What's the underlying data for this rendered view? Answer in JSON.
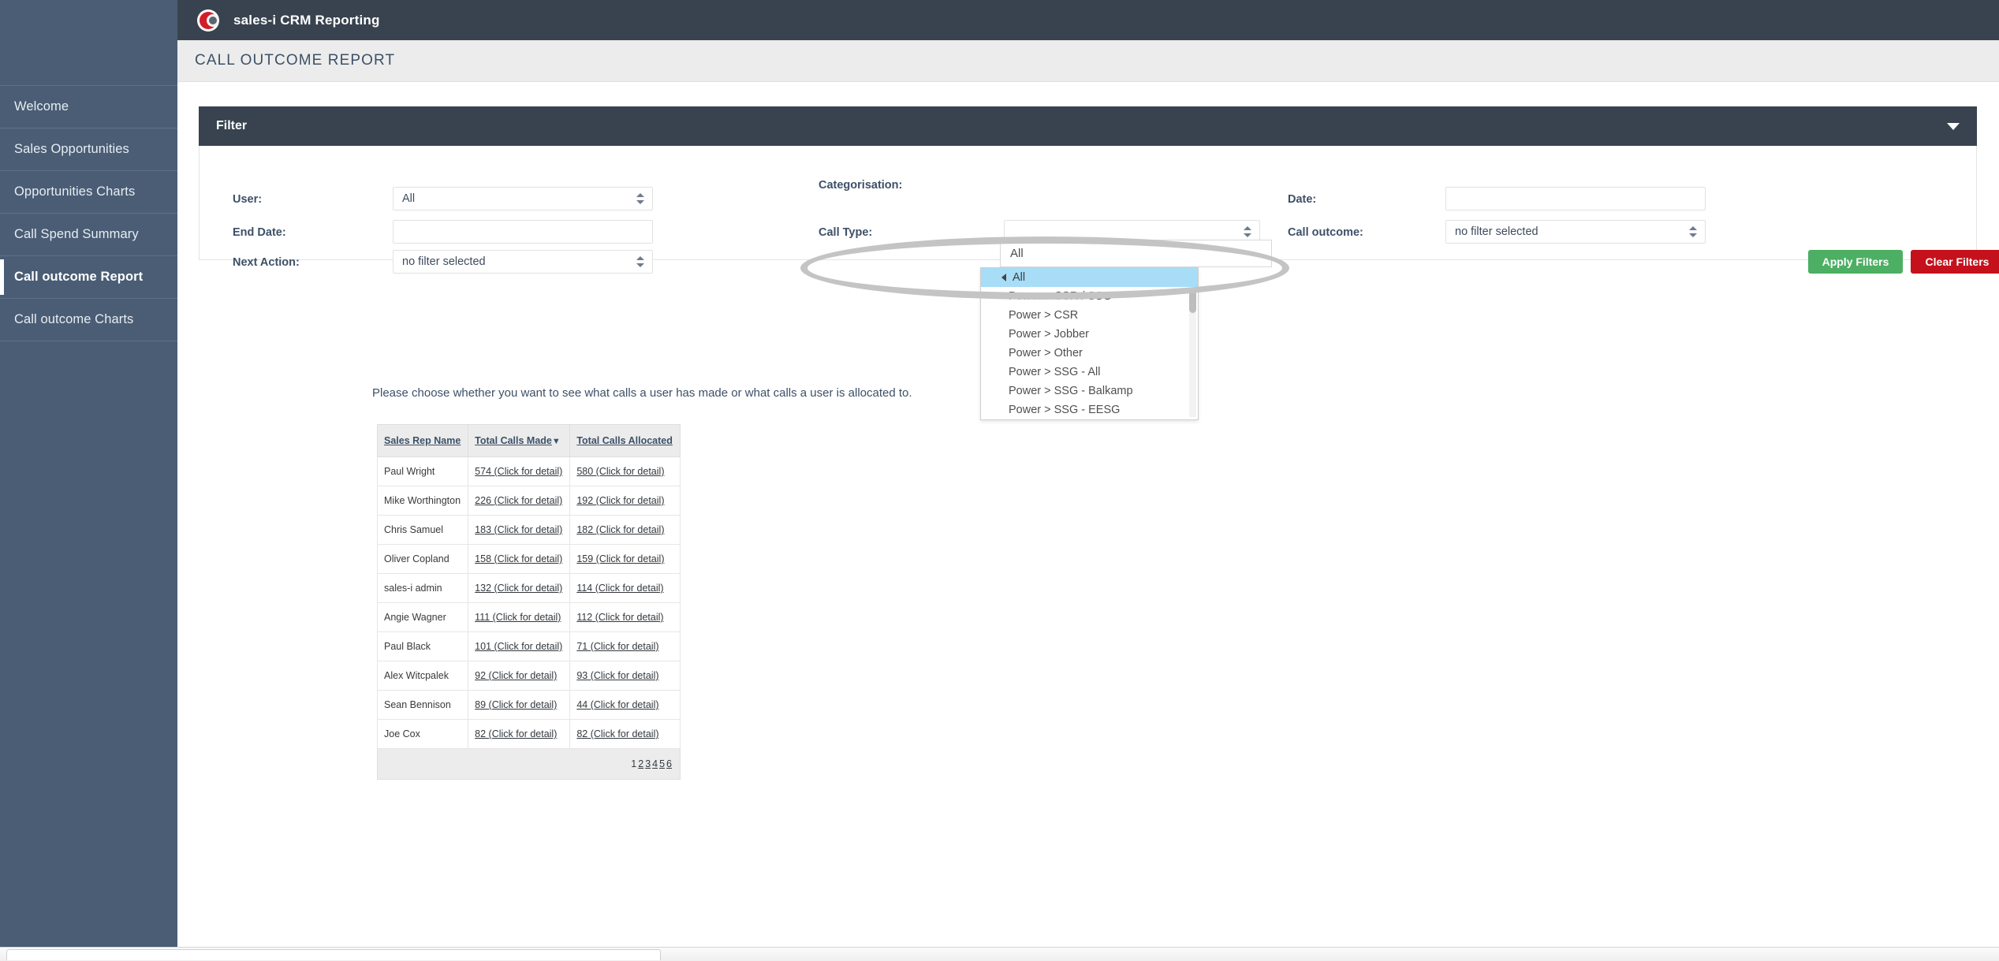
{
  "app": {
    "brand": "sales-i CRM Reporting",
    "logo_icon": "sales-i-logo-icon",
    "page_title": "CALL OUTCOME REPORT"
  },
  "sidebar": {
    "items": [
      {
        "label": "Welcome",
        "active": false
      },
      {
        "label": "Sales Opportunities",
        "active": false
      },
      {
        "label": "Opportunities Charts",
        "active": false
      },
      {
        "label": "Call Spend Summary",
        "active": false
      },
      {
        "label": "Call outcome Report",
        "active": true
      },
      {
        "label": "Call outcome Charts",
        "active": false
      }
    ]
  },
  "filter": {
    "title": "Filter",
    "collapse_icon": "chevron-down-icon",
    "fields": {
      "user": {
        "label": "User:",
        "value": "All"
      },
      "end_date": {
        "label": "End Date:",
        "value": ""
      },
      "next_action": {
        "label": "Next Action:",
        "value": "no filter selected"
      },
      "categorisation": {
        "label": "Categorisation:",
        "value": "All"
      },
      "call_type": {
        "label": "Call Type:",
        "value": ""
      },
      "start_date": {
        "label": "Date:",
        "value": ""
      },
      "call_outcome": {
        "label": "Call outcome:",
        "value": "no filter selected"
      }
    },
    "buttons": {
      "apply": "Apply Filters",
      "clear": "Clear Filters",
      "apply_color": "#4caf63",
      "clear_color": "#c5111c"
    }
  },
  "categorisation_dropdown": {
    "open": true,
    "options": [
      "All",
      "Power > CSR / SSG",
      "Power > CSR",
      "Power > Jobber",
      "Power > Other",
      "Power > SSG - All",
      "Power > SSG - Balkamp",
      "Power > SSG - EESG"
    ],
    "selected": "All",
    "highlight_color": "#a7ddf7"
  },
  "main": {
    "instruction": "Please choose whether you want to see what calls a user has made or what calls a user is allocated to."
  },
  "table": {
    "columns": [
      "Sales Rep Name",
      "Total Calls Made",
      "Total Calls Allocated"
    ],
    "sort_column": "Total Calls Made",
    "sort_arrow": "▼",
    "detail_text": "(Click for detail)",
    "rows": [
      {
        "name": "Paul Wright",
        "made": "574",
        "allocated": "580"
      },
      {
        "name": "Mike Worthington",
        "made": "226",
        "allocated": "192"
      },
      {
        "name": "Chris Samuel",
        "made": "183",
        "allocated": "182"
      },
      {
        "name": "Oliver Copland",
        "made": "158",
        "allocated": "159"
      },
      {
        "name": "sales-i admin",
        "made": "132",
        "allocated": "114"
      },
      {
        "name": "Angie Wagner",
        "made": "111",
        "allocated": "112"
      },
      {
        "name": "Paul Black",
        "made": "101",
        "allocated": "71"
      },
      {
        "name": "Alex Witcpalek",
        "made": "92",
        "allocated": "93"
      },
      {
        "name": "Sean Bennison",
        "made": "89",
        "allocated": "44"
      },
      {
        "name": "Joe Cox",
        "made": "82",
        "allocated": "82"
      }
    ],
    "pagination": [
      "1",
      "2",
      "3",
      "4",
      "5",
      "6"
    ],
    "current_page": "1"
  },
  "colors": {
    "sidebar": "#4a5d75",
    "topbar": "#38434f",
    "titlebar": "#ececec",
    "accent_text": "#3d5068"
  }
}
